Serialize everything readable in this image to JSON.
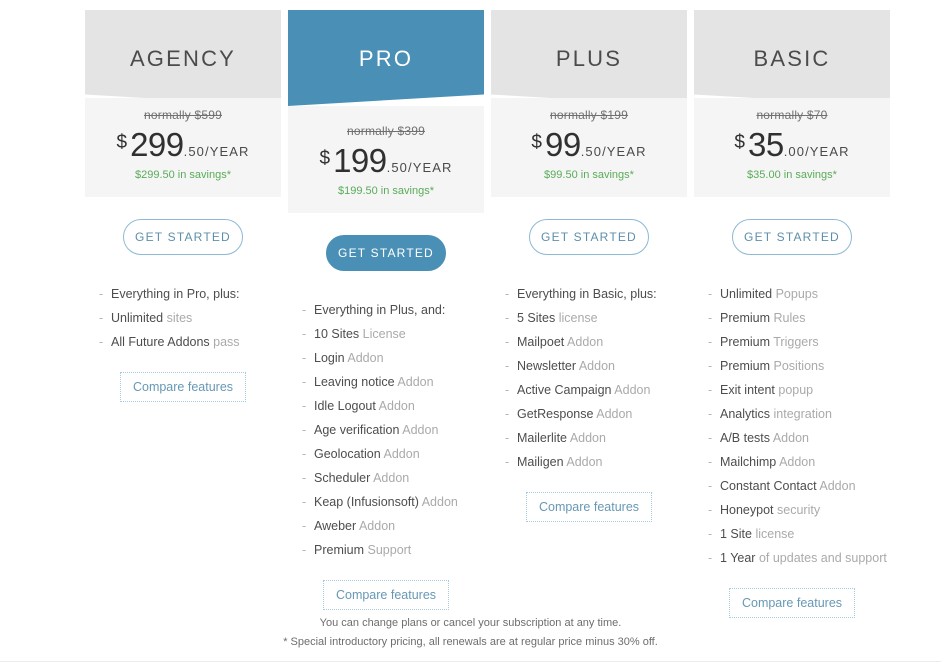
{
  "plans": [
    {
      "name": "AGENCY",
      "featured": false,
      "normally": "normally $599",
      "currency": "$",
      "amount": "299",
      "per": ".50/YEAR",
      "savings": "$299.50 in savings*",
      "cta": "GET STARTED",
      "compare": "Compare features",
      "features": [
        {
          "main": "Everything in Pro, plus:",
          "muted": ""
        },
        {
          "main": "Unlimited",
          "muted": "sites"
        },
        {
          "main": "All Future Addons",
          "muted": "pass"
        }
      ]
    },
    {
      "name": "PRO",
      "featured": true,
      "normally": "normally $399",
      "currency": "$",
      "amount": "199",
      "per": ".50/YEAR",
      "savings": "$199.50 in savings*",
      "cta": "GET STARTED",
      "compare": "Compare features",
      "features": [
        {
          "main": "Everything in Plus, and:",
          "muted": ""
        },
        {
          "main": "10 Sites",
          "muted": "License"
        },
        {
          "main": "Login",
          "muted": "Addon"
        },
        {
          "main": "Leaving notice",
          "muted": "Addon"
        },
        {
          "main": "Idle Logout",
          "muted": "Addon"
        },
        {
          "main": "Age verification",
          "muted": "Addon"
        },
        {
          "main": "Geolocation",
          "muted": "Addon"
        },
        {
          "main": "Scheduler",
          "muted": "Addon"
        },
        {
          "main": "Keap (Infusionsoft)",
          "muted": "Addon"
        },
        {
          "main": "Aweber",
          "muted": "Addon"
        },
        {
          "main": "Premium",
          "muted": "Support"
        }
      ]
    },
    {
      "name": "PLUS",
      "featured": false,
      "normally": "normally $199",
      "currency": "$",
      "amount": "99",
      "per": ".50/YEAR",
      "savings": "$99.50 in savings*",
      "cta": "GET STARTED",
      "compare": "Compare features",
      "features": [
        {
          "main": "Everything in Basic, plus:",
          "muted": ""
        },
        {
          "main": "5 Sites",
          "muted": "license"
        },
        {
          "main": "Mailpoet",
          "muted": "Addon"
        },
        {
          "main": "Newsletter",
          "muted": "Addon"
        },
        {
          "main": "Active Campaign",
          "muted": "Addon"
        },
        {
          "main": "GetResponse",
          "muted": "Addon"
        },
        {
          "main": "Mailerlite",
          "muted": "Addon"
        },
        {
          "main": "Mailigen",
          "muted": "Addon"
        }
      ]
    },
    {
      "name": "BASIC",
      "featured": false,
      "normally": "normally $70",
      "currency": "$",
      "amount": "35",
      "per": ".00/YEAR",
      "savings": "$35.00 in savings*",
      "cta": "GET STARTED",
      "compare": "Compare features",
      "features": [
        {
          "main": "Unlimited",
          "muted": "Popups"
        },
        {
          "main": "Premium",
          "muted": "Rules"
        },
        {
          "main": "Premium",
          "muted": "Triggers"
        },
        {
          "main": "Premium",
          "muted": "Positions"
        },
        {
          "main": "Exit intent",
          "muted": "popup"
        },
        {
          "main": "Analytics",
          "muted": "integration"
        },
        {
          "main": "A/B tests",
          "muted": "Addon"
        },
        {
          "main": "Mailchimp",
          "muted": "Addon"
        },
        {
          "main": "Constant Contact",
          "muted": "Addon"
        },
        {
          "main": "Honeypot",
          "muted": "security"
        },
        {
          "main": "1 Site",
          "muted": "license"
        },
        {
          "main": "1 Year",
          "muted": "of updates and support"
        }
      ]
    }
  ],
  "footer": {
    "line1": "You can change plans or cancel your subscription at any time.",
    "line2": "* Special introductory pricing, all renewals are at regular price minus 30% off."
  },
  "colors": {
    "accent": "#4a90b6",
    "header_gray": "#e4e4e4",
    "card_body": "#f5f5f5",
    "savings_green": "#5aab5a",
    "text_dark": "#4d4d4d",
    "text_muted": "#aaaaaa"
  }
}
